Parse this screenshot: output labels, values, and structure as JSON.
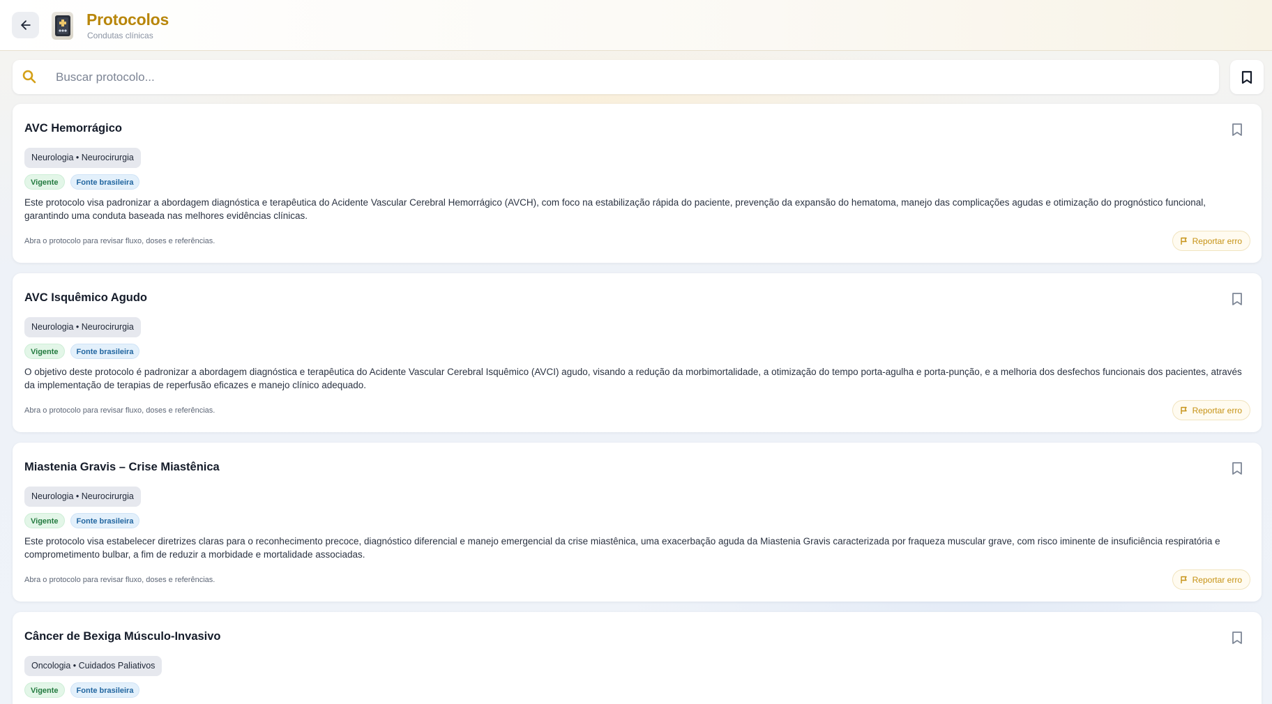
{
  "header": {
    "title": "Protocolos",
    "subtitle": "Condutas clínicas",
    "back_icon": "arrow-left-icon",
    "logo_icon": "medical-book-icon"
  },
  "search": {
    "placeholder": "Buscar protocolo...",
    "value": "",
    "icon": "search-icon"
  },
  "bookmarks_button_icon": "bookmark-icon",
  "colors": {
    "brand": "#b8860b",
    "accent_search": "#d4a017",
    "tag_green": "#237a3f",
    "tag_blue": "#2266a0",
    "report": "#c69214"
  },
  "protocols": [
    {
      "title": "AVC Hemorrágico",
      "category": "Neurologia • Neurocirurgia",
      "tags": [
        "Vigente",
        "Fonte brasileira"
      ],
      "description": "Este protocolo visa padronizar a abordagem diagnóstica e terapêutica do Acidente Vascular Cerebral Hemorrágico (AVCH), com foco na estabilização rápida do paciente, prevenção da expansão do hematoma, manejo das complicações agudas e otimização do prognóstico funcional, garantindo uma conduta baseada nas melhores evidências clínicas.",
      "hint": "Abra o protocolo para revisar fluxo, doses e referências.",
      "report_label": "Reportar erro"
    },
    {
      "title": "AVC Isquêmico Agudo",
      "category": "Neurologia • Neurocirurgia",
      "tags": [
        "Vigente",
        "Fonte brasileira"
      ],
      "description": "O objetivo deste protocolo é padronizar a abordagem diagnóstica e terapêutica do Acidente Vascular Cerebral Isquêmico (AVCI) agudo, visando a redução da morbimortalidade, a otimização do tempo porta-agulha e porta-punção, e a melhoria dos desfechos funcionais dos pacientes, através da implementação de terapias de reperfusão eficazes e manejo clínico adequado.",
      "hint": "Abra o protocolo para revisar fluxo, doses e referências.",
      "report_label": "Reportar erro"
    },
    {
      "title": "Miastenia Gravis – Crise Miastênica",
      "category": "Neurologia • Neurocirurgia",
      "tags": [
        "Vigente",
        "Fonte brasileira"
      ],
      "description": "Este protocolo visa estabelecer diretrizes claras para o reconhecimento precoce, diagnóstico diferencial e manejo emergencial da crise miastênica, uma exacerbação aguda da Miastenia Gravis caracterizada por fraqueza muscular grave, com risco iminente de insuficiência respiratória e comprometimento bulbar, a fim de reduzir a morbidade e mortalidade associadas.",
      "hint": "Abra o protocolo para revisar fluxo, doses e referências.",
      "report_label": "Reportar erro"
    },
    {
      "title": "Câncer de Bexiga Músculo-Invasivo",
      "category": "Oncologia • Cuidados Paliativos",
      "tags": [
        "Vigente",
        "Fonte brasileira"
      ]
    }
  ]
}
